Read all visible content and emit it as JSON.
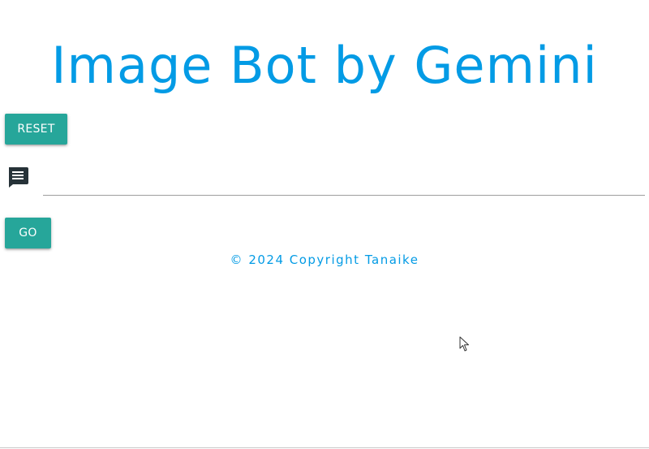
{
  "header": {
    "title": "Image Bot by Gemini"
  },
  "controls": {
    "reset_label": "RESET",
    "go_label": "GO",
    "prompt_value": "",
    "prompt_placeholder": ""
  },
  "footer": {
    "copyright": "© 2024 Copyright Tanaike"
  },
  "icons": {
    "chat": "chat-icon",
    "cursor": "mouse-pointer-icon"
  },
  "colors": {
    "title": "#039be5",
    "button": "#26a69a",
    "footer_text": "#039be5"
  }
}
